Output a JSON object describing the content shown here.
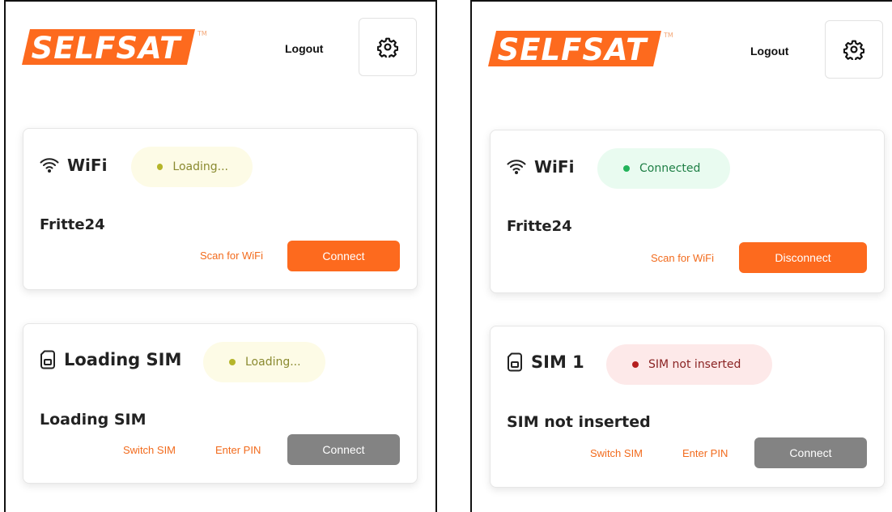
{
  "colors": {
    "brand_orange": "#fd6a1e",
    "disabled_grey": "#838383"
  },
  "logo": {
    "text": "SELFSAT",
    "tm": "TM"
  },
  "left": {
    "header": {
      "logout_label": "Logout"
    },
    "wifi": {
      "title": "WiFi",
      "status": "Loading...",
      "network": "Fritte24",
      "scan_label": "Scan for WiFi",
      "action_label": "Connect"
    },
    "sim": {
      "title": "Loading SIM",
      "status": "Loading...",
      "state": "Loading SIM",
      "switch_label": "Switch SIM",
      "pin_label": "Enter PIN",
      "action_label": "Connect"
    }
  },
  "right": {
    "header": {
      "logout_label": "Logout"
    },
    "wifi": {
      "title": "WiFi",
      "status": "Connected",
      "network": "Fritte24",
      "scan_label": "Scan for WiFi",
      "action_label": "Disconnect"
    },
    "sim": {
      "title": "SIM 1",
      "status": "SIM not inserted",
      "state": "SIM not inserted",
      "switch_label": "Switch SIM",
      "pin_label": "Enter PIN",
      "action_label": "Connect"
    }
  }
}
